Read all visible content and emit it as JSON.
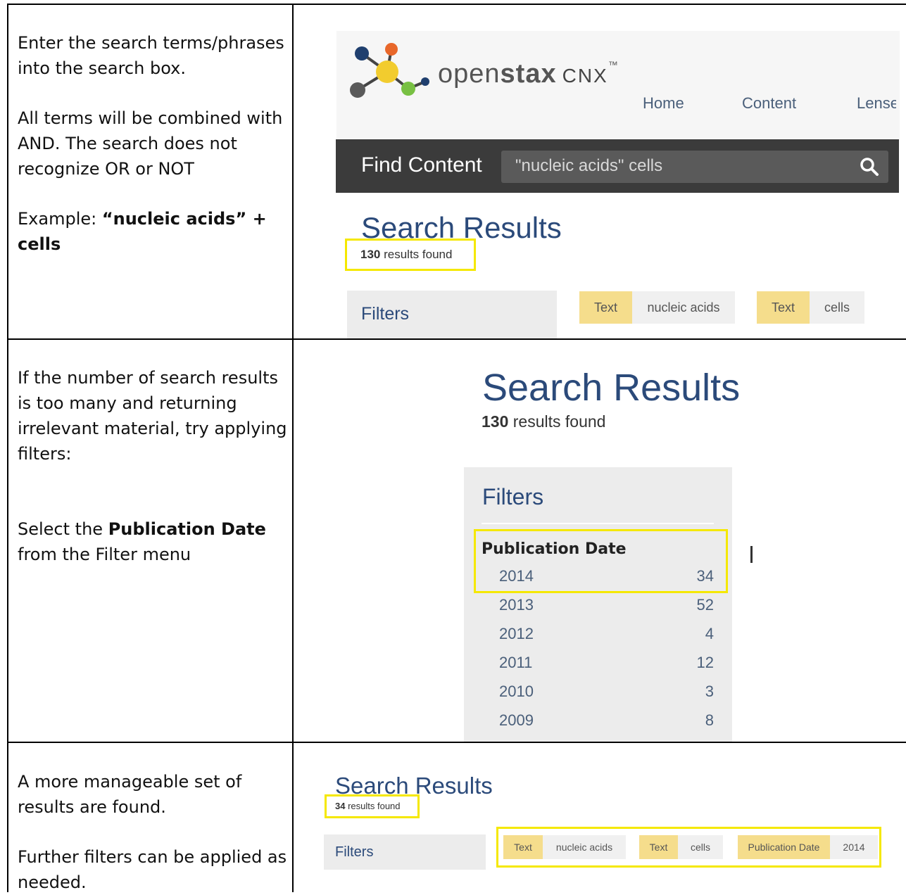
{
  "rows": [
    {
      "paragraphs": [
        "Enter the search terms/phrases into the search box.",
        "All terms will be combined with AND. The search does not recognize OR or NOT"
      ],
      "example_prefix": "Example: ",
      "example_bold": "“nucleic acids” + cells"
    },
    {
      "paragraph1": "If the number of search results is too many and returning irrelevant material, try applying filters:",
      "select_prefix": "Select the ",
      "select_bold": "Publication Date",
      "select_suffix": "from the Filter menu"
    },
    {
      "paragraph1": "A more manageable set of results are found.",
      "paragraph2": "Further filters can be applied as needed."
    }
  ],
  "site": {
    "logo_text_light": "open",
    "logo_text_bold": "stax",
    "logo_text_cnx": "CNX",
    "logo_tm": "™",
    "nav": [
      "Home",
      "Content",
      "Lense"
    ],
    "find_label": "Find Content",
    "search_value": "\"nucleic acids\" cells"
  },
  "screen1": {
    "title": "Search Results",
    "count_number": "130",
    "count_suffix": " results found",
    "filters_label": "Filters",
    "chips": [
      {
        "key": "Text",
        "value": "nucleic acids"
      },
      {
        "key": "Text",
        "value": "cells"
      }
    ]
  },
  "screen2": {
    "title": "Search Results",
    "count_number": "130",
    "count_suffix": " results found",
    "filters_label": "Filters",
    "pub_date_label": "Publication Date",
    "years": [
      {
        "year": "2014",
        "count": "34"
      },
      {
        "year": "2013",
        "count": "52"
      },
      {
        "year": "2012",
        "count": "4"
      },
      {
        "year": "2011",
        "count": "12"
      },
      {
        "year": "2010",
        "count": "3"
      },
      {
        "year": "2009",
        "count": "8"
      }
    ]
  },
  "screen3": {
    "title": "Search Results",
    "count_number": "34",
    "count_suffix": " results found",
    "filters_label": "Filters",
    "chips": [
      {
        "key": "Text",
        "value": "nucleic acids"
      },
      {
        "key": "Text",
        "value": "cells"
      },
      {
        "key": "Publication Date",
        "value": "2014"
      }
    ]
  },
  "colors": {
    "highlight": "#f5e800",
    "heading_blue": "#2b4a7a",
    "chip_key": "#f5dd8c",
    "dark_bar": "#3b3b3b"
  }
}
